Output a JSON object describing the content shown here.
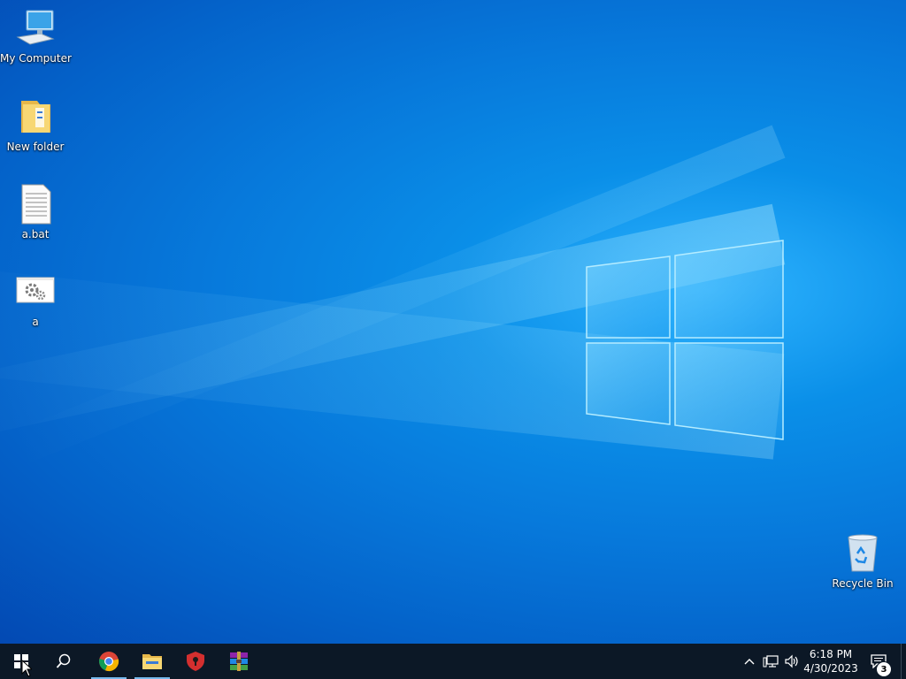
{
  "desktop": {
    "icons": [
      {
        "label": "My Computer",
        "icon": "computer-icon"
      },
      {
        "label": "New folder",
        "icon": "folder-icon"
      },
      {
        "label": "a.bat",
        "icon": "batch-file-icon"
      },
      {
        "label": "a",
        "icon": "gears-shortcut-icon"
      },
      {
        "label": "Recycle Bin",
        "icon": "recycle-bin-icon"
      }
    ]
  },
  "taskbar": {
    "apps": [
      {
        "name": "start-button",
        "icon": "windows-start-icon"
      },
      {
        "name": "search-button",
        "icon": "search-icon"
      },
      {
        "name": "chrome",
        "icon": "chrome-icon",
        "running": true
      },
      {
        "name": "file-explorer",
        "icon": "folder-icon",
        "running": true
      },
      {
        "name": "shield-app",
        "icon": "red-shield-icon"
      },
      {
        "name": "winrar",
        "icon": "winrar-icon"
      }
    ],
    "tray": {
      "icons": [
        "chevron-up-icon",
        "network-icon",
        "volume-icon"
      ],
      "time": "6:18 PM",
      "date": "4/30/2023",
      "notification_count": "3"
    }
  },
  "colors": {
    "taskbar": "#0c1826",
    "accent": "#76b9ed",
    "desktop": "#0779db"
  }
}
